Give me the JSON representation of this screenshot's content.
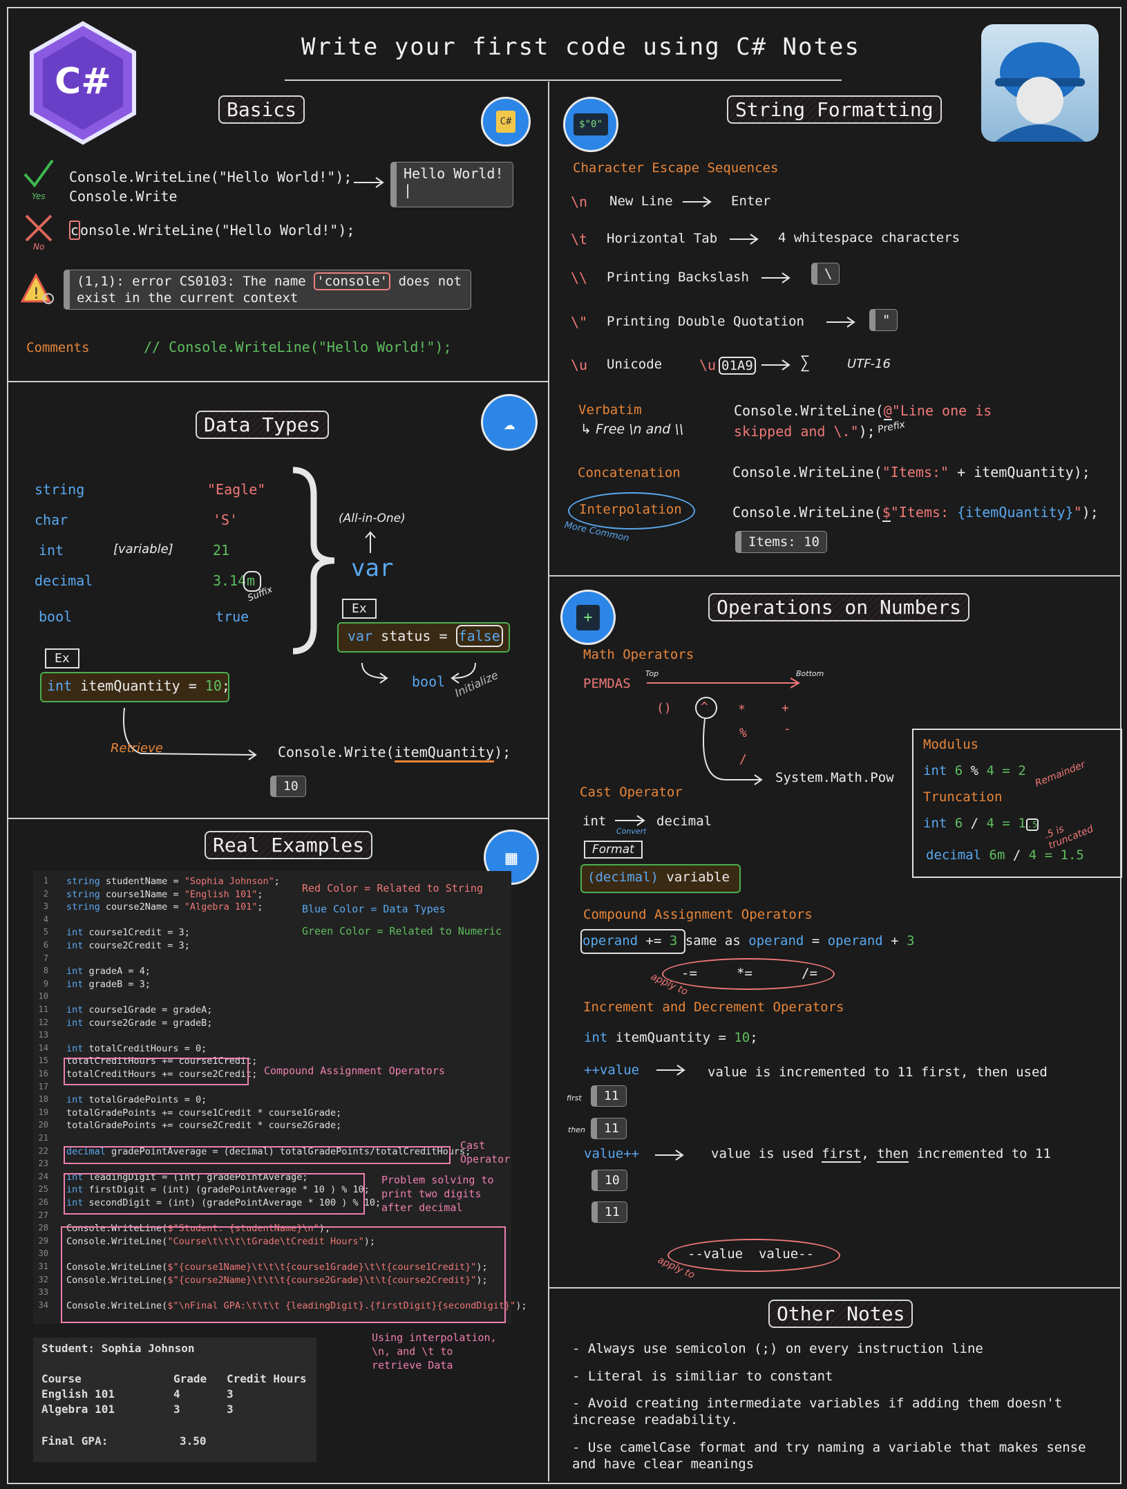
{
  "header": {
    "title": "Write your first code using C# Notes",
    "logo_text": "C#"
  },
  "basics": {
    "heading": "Basics",
    "yes_label": "Yes",
    "no_label": "No",
    "writeline_good": "Console.WriteLine(\"Hello World!\");",
    "write_good": "Console.Write",
    "term_output_line1": "Hello World!",
    "term_output_line2": "|",
    "writeline_bad_first": "c",
    "writeline_bad_rest": "onsole.WriteLine(\"Hello World!\");",
    "error_part1": "(1,1): error CS0103: The name ",
    "error_highlight": "'console'",
    "error_part2": " does not",
    "error_line2": "exist in the current context",
    "comments_label": "Comments",
    "comments_code": "// Console.WriteLine(\"Hello World!\");"
  },
  "data_types": {
    "heading": "Data Types",
    "rows": [
      {
        "type": "string",
        "value": "\"Eagle\""
      },
      {
        "type": "char",
        "value": "'S'"
      },
      {
        "type": "int",
        "value": "21"
      },
      {
        "type": "decimal",
        "value": "3.14"
      },
      {
        "type": "bool",
        "value": "true"
      }
    ],
    "variable_label": "[variable]",
    "decimal_suffix": "m",
    "suffix_note": "Suffix",
    "all_in_one": "(All-in-One)",
    "var_keyword": "var",
    "ex_label": "Ex",
    "var_example_kw": "var",
    "var_example_mid": " status = ",
    "var_example_val": "false",
    "bool_label": "bool",
    "initialize_note": "Initialize",
    "int_example_kw": "int",
    "int_example_mid": " itemQuantity = ",
    "int_example_val": "10",
    "int_example_end": ";",
    "retrieve_note": "Retrieve",
    "console_write_pre": "Console.Write(",
    "console_write_arg": "itemQuantity",
    "console_write_post": ");",
    "term_output": "10"
  },
  "string_formatting": {
    "heading": "String Formatting",
    "escape_heading": "Character Escape Sequences",
    "escapes": [
      {
        "seq": "\\n",
        "name": "New Line",
        "result": "Enter"
      },
      {
        "seq": "\\t",
        "name": "Horizontal Tab",
        "result": "4 whitespace characters"
      },
      {
        "seq": "\\\\",
        "name": "Printing Backslash",
        "result": "\\"
      },
      {
        "seq": "\\\"",
        "name": "Printing Double Quotation",
        "result": "\""
      },
      {
        "seq": "\\u",
        "name": "Unicode",
        "result": "01A9"
      }
    ],
    "unicode_prefix": "\\u",
    "unicode_sigma": "∑",
    "unicode_encoding": "UTF-16",
    "verbatim_label": "Verbatim",
    "verbatim_note": "Free \\n and \\\\",
    "verbatim_code_pre": "Console.WriteLine(",
    "verbatim_code_at": "@",
    "verbatim_code_str1": "\"Line one is",
    "verbatim_code_str2": "skipped and \\.\"",
    "verbatim_code_end": ");",
    "prefix_note": "Prefix",
    "concat_label": "Concatenation",
    "concat_code_pre": "Console.WriteLine(",
    "concat_code_str": "\"Items:\"",
    "concat_code_plus": " + ",
    "concat_code_var": "itemQuantity",
    "concat_code_end": ");",
    "interp_label": "Interpolation",
    "interp_note": "More Common",
    "interp_code_pre": "Console.WriteLine(",
    "interp_code_dollar": "$",
    "interp_code_str1": "\"Items: ",
    "interp_code_var": "{itemQuantity}",
    "interp_code_str2": "\"",
    "interp_code_end": ");",
    "term_output": "Items: 10"
  },
  "operations": {
    "heading": "Operations on Numbers",
    "math_label": "Math Operators",
    "pemdas": "PEMDAS",
    "top_note": "Top",
    "bottom_note": "Bottom",
    "ops": [
      "()",
      "^",
      "*",
      "+",
      "%",
      "-",
      "/"
    ],
    "math_pow": "System.Math.Pow",
    "modulus_label": "Modulus",
    "modulus_code": [
      "int",
      " 6 ",
      "%",
      " 4 = ",
      "2"
    ],
    "remainder_note": "Remainder",
    "truncation_label": "Truncation",
    "truncation_code": [
      "int",
      " 6 ",
      "/",
      " 4 = ",
      "1",
      ".5"
    ],
    "truncated_note": ".5 is truncated",
    "decimal_code": [
      "decimal",
      " 6m ",
      "/",
      " 4 = ",
      "1.5"
    ],
    "cast_label": "Cast Operator",
    "cast_from": "int",
    "cast_to": "decimal",
    "convert_note": "Convert",
    "format_label": "Format",
    "cast_example_kw": "(decimal)",
    "cast_example_rest": " variable",
    "compound_label": "Compound Assignment Operators",
    "compound_operand": "operand",
    "compound_op": " += ",
    "compound_num": "3",
    "compound_same": " same as ",
    "compound_eq": " = ",
    "compound_plus": " + ",
    "compound_others": [
      "-=",
      "*=",
      "/="
    ],
    "apply_to_note": "apply to",
    "incdec_label": "Increment and Decrement Operators",
    "incdec_decl_kw": "int",
    "incdec_decl_mid": " itemQuantity = ",
    "incdec_decl_val": "10",
    "incdec_decl_end": ";",
    "prefix_code": "++value",
    "prefix_desc": "value is incremented to 11 first, then used",
    "first_note": "first",
    "then_note": "then",
    "prefix_out1": "11",
    "prefix_out2": "11",
    "postfix_code": "value++",
    "postfix_desc_1": "value is used ",
    "postfix_desc_first": "first",
    "postfix_desc_2": ", ",
    "postfix_desc_then": "then",
    "postfix_desc_3": " incremented to 11",
    "postfix_out1": "10",
    "postfix_out2": "11",
    "dec_ops": "--value  value--",
    "apply_to_note2": "apply to"
  },
  "real_examples": {
    "heading": "Real Examples",
    "legend_red": "Red Color = Related to String",
    "legend_blue": "Blue Color = Data Types",
    "legend_green": "Green Color = Related to Numeric",
    "note_compound": "Compound Assignment Operators",
    "note_cast_1": "Cast",
    "note_cast_2": "Operator",
    "note_problem": [
      "Problem solving to",
      "print two digits",
      "after decimal"
    ],
    "note_interp": [
      "Using interpolation,",
      "\\n, and \\t to",
      "retrieve Data"
    ],
    "code_lines": [
      {
        "n": "1",
        "kw": "string",
        "rest": " studentName = ",
        "str": "\"Sophia Johnson\"",
        "end": ";"
      },
      {
        "n": "2",
        "kw": "string",
        "rest": " course1Name = ",
        "str": "\"English 101\"",
        "end": ";"
      },
      {
        "n": "3",
        "kw": "string",
        "rest": " course2Name = ",
        "str": "\"Algebra 101\"",
        "end": ";"
      },
      {
        "n": "4",
        "kw": "",
        "rest": "",
        "str": "",
        "end": ""
      },
      {
        "n": "5",
        "kw": "int",
        "rest": " course1Credit = 3;",
        "str": "",
        "end": ""
      },
      {
        "n": "6",
        "kw": "int",
        "rest": " course2Credit = 3;",
        "str": "",
        "end": ""
      },
      {
        "n": "7",
        "kw": "",
        "rest": "",
        "str": "",
        "end": ""
      },
      {
        "n": "8",
        "kw": "int",
        "rest": " gradeA = 4;",
        "str": "",
        "end": ""
      },
      {
        "n": "9",
        "kw": "int",
        "rest": " gradeB = 3;",
        "str": "",
        "end": ""
      },
      {
        "n": "10",
        "kw": "",
        "rest": "",
        "str": "",
        "end": ""
      },
      {
        "n": "11",
        "kw": "int",
        "rest": " course1Grade = gradeA;",
        "str": "",
        "end": ""
      },
      {
        "n": "12",
        "kw": "int",
        "rest": " course2Grade = gradeB;",
        "str": "",
        "end": ""
      },
      {
        "n": "13",
        "kw": "",
        "rest": "",
        "str": "",
        "end": ""
      },
      {
        "n": "14",
        "kw": "int",
        "rest": " totalCreditHours = 0;",
        "str": "",
        "end": ""
      },
      {
        "n": "15",
        "kw": "",
        "rest": "totalCreditHours += course1Credit;",
        "str": "",
        "end": ""
      },
      {
        "n": "16",
        "kw": "",
        "rest": "totalCreditHours += course2Credit;",
        "str": "",
        "end": ""
      },
      {
        "n": "17",
        "kw": "",
        "rest": "",
        "str": "",
        "end": ""
      },
      {
        "n": "18",
        "kw": "int",
        "rest": " totalGradePoints = 0;",
        "str": "",
        "end": ""
      },
      {
        "n": "19",
        "kw": "",
        "rest": "totalGradePoints += course1Credit * course1Grade;",
        "str": "",
        "end": ""
      },
      {
        "n": "20",
        "kw": "",
        "rest": "totalGradePoints += course2Credit * course2Grade;",
        "str": "",
        "end": ""
      },
      {
        "n": "21",
        "kw": "",
        "rest": "",
        "str": "",
        "end": ""
      },
      {
        "n": "22",
        "kw": "decimal",
        "rest": " gradePointAverage = (decimal) totalGradePoints/totalCreditHours;",
        "str": "",
        "end": ""
      },
      {
        "n": "23",
        "kw": "",
        "rest": "",
        "str": "",
        "end": ""
      },
      {
        "n": "24",
        "kw": "int",
        "rest": " leadingDigit = (int) gradePointAverage;",
        "str": "",
        "end": ""
      },
      {
        "n": "25",
        "kw": "int",
        "rest": " firstDigit = (int) (gradePointAverage * 10 ) % 10;",
        "str": "",
        "end": ""
      },
      {
        "n": "26",
        "kw": "int",
        "rest": " secondDigit = (int) (gradePointAverage * 100 ) % 10;",
        "str": "",
        "end": ""
      },
      {
        "n": "27",
        "kw": "",
        "rest": "",
        "str": "",
        "end": ""
      },
      {
        "n": "28",
        "kw": "",
        "rest": "Console.WriteLine(",
        "str": "$\"Student: {studentName}\\n\"",
        "end": ");"
      },
      {
        "n": "29",
        "kw": "",
        "rest": "Console.WriteLine(",
        "str": "\"Course\\t\\t\\t\\tGrade\\tCredit Hours\"",
        "end": ");"
      },
      {
        "n": "30",
        "kw": "",
        "rest": "",
        "str": "",
        "end": ""
      },
      {
        "n": "31",
        "kw": "",
        "rest": "Console.WriteLine(",
        "str": "$\"{course1Name}\\t\\t\\t{course1Grade}\\t\\t{course1Credit}\"",
        "end": ");"
      },
      {
        "n": "32",
        "kw": "",
        "rest": "Console.WriteLine(",
        "str": "$\"{course2Name}\\t\\t\\t{course2Grade}\\t\\t{course2Credit}\"",
        "end": ");"
      },
      {
        "n": "33",
        "kw": "",
        "rest": "",
        "str": "",
        "end": ""
      },
      {
        "n": "34",
        "kw": "",
        "rest": "Console.WriteLine(",
        "str": "$\"\\nFinal GPA:\\t\\t\\t {leadingDigit}.{firstDigit}{secondDigit}\"",
        "end": ");"
      }
    ],
    "output": {
      "student": "Student: Sophia Johnson",
      "header": [
        "Course",
        "Grade",
        "Credit Hours"
      ],
      "rows": [
        [
          "English 101",
          "4",
          "3"
        ],
        [
          "Algebra 101",
          "3",
          "3"
        ]
      ],
      "gpa_label": "Final GPA:",
      "gpa_value": "3.50"
    }
  },
  "other_notes": {
    "heading": "Other Notes",
    "items": [
      "- Always use semicolon (;) on every instruction line",
      "- Literal is similiar to constant",
      "- Avoid creating intermediate variables if adding them doesn't",
      "increase readability.",
      "- Use camelCase format and try naming a variable that makes sense",
      "and have clear meanings"
    ]
  },
  "colors": {
    "string": "#f07878",
    "type": "#5aa8f0",
    "numeric": "#5fbf5f",
    "label": "#e8863a"
  }
}
